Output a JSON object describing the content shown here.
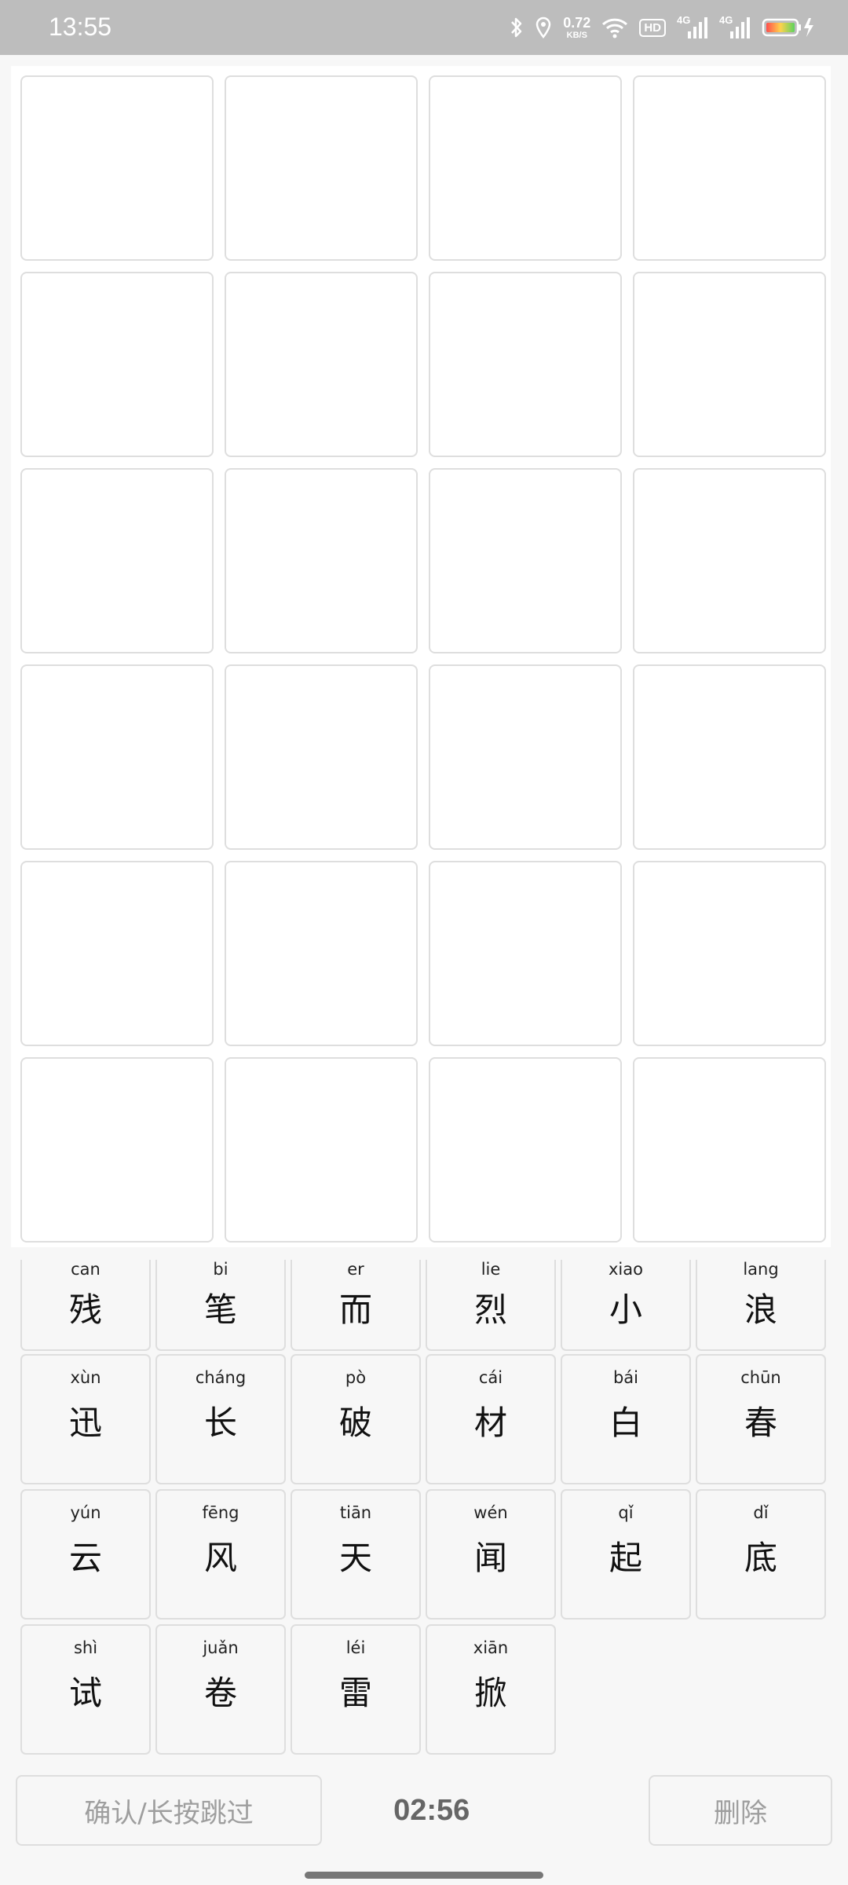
{
  "status_bar": {
    "time": "13:55",
    "net_speed_value": "0.72",
    "net_speed_unit": "KB/S",
    "hd_label": "HD",
    "signal_labels": [
      "4G",
      "4G"
    ],
    "battery_icon": "battery-charging-icon"
  },
  "answer_grid": {
    "rows": 6,
    "cols": 4
  },
  "char_bank": {
    "rows": [
      [
        {
          "pinyin": "can",
          "hanzi": "残"
        },
        {
          "pinyin": "bi",
          "hanzi": "笔"
        },
        {
          "pinyin": "er",
          "hanzi": "而"
        },
        {
          "pinyin": "lie",
          "hanzi": "烈"
        },
        {
          "pinyin": "xiao",
          "hanzi": "小"
        },
        {
          "pinyin": "lang",
          "hanzi": "浪"
        }
      ],
      [
        {
          "pinyin": "xùn",
          "hanzi": "迅"
        },
        {
          "pinyin": "cháng",
          "hanzi": "长"
        },
        {
          "pinyin": "pò",
          "hanzi": "破"
        },
        {
          "pinyin": "cái",
          "hanzi": "材"
        },
        {
          "pinyin": "bái",
          "hanzi": "白"
        },
        {
          "pinyin": "chūn",
          "hanzi": "春"
        }
      ],
      [
        {
          "pinyin": "yún",
          "hanzi": "云"
        },
        {
          "pinyin": "fēng",
          "hanzi": "风"
        },
        {
          "pinyin": "tiān",
          "hanzi": "天"
        },
        {
          "pinyin": "wén",
          "hanzi": "闻"
        },
        {
          "pinyin": "qǐ",
          "hanzi": "起"
        },
        {
          "pinyin": "dǐ",
          "hanzi": "底"
        }
      ],
      [
        {
          "pinyin": "shì",
          "hanzi": "试"
        },
        {
          "pinyin": "juǎn",
          "hanzi": "卷"
        },
        {
          "pinyin": "léi",
          "hanzi": "雷"
        },
        {
          "pinyin": "xiān",
          "hanzi": "掀"
        }
      ]
    ]
  },
  "controls": {
    "confirm_label": "确认/长按跳过",
    "timer": "02:56",
    "delete_label": "删除"
  }
}
